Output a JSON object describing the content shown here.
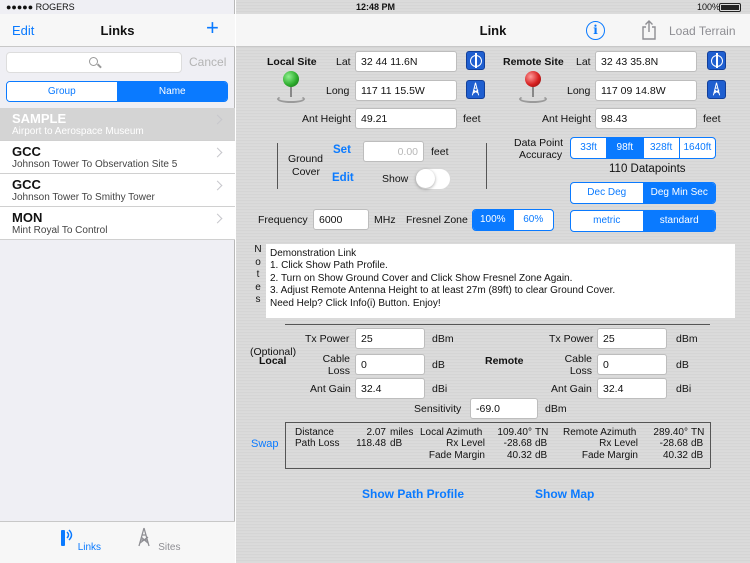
{
  "status": {
    "carrier": "●●●●● ROGERS",
    "time": "12:48 PM",
    "battery": "100%"
  },
  "left": {
    "edit": "Edit",
    "title": "Links",
    "add": "+",
    "cancel": "Cancel",
    "segments": [
      "Group",
      "Name"
    ],
    "items": [
      {
        "title": "SAMPLE",
        "subtitle": "Airport to Aerospace Museum"
      },
      {
        "title": "GCC",
        "subtitle": "Johnson Tower To Observation Site 5"
      },
      {
        "title": "GCC",
        "subtitle": "Johnson Tower To Smithy Tower"
      },
      {
        "title": "MON",
        "subtitle": "Mint Royal To Control"
      }
    ],
    "tabs": {
      "links": "Links",
      "sites": "Sites"
    }
  },
  "nav": {
    "title": "Link",
    "info": "i",
    "load_terrain": "Load Terrain"
  },
  "local": {
    "label": "Local Site",
    "lat": "32 44 11.6N",
    "long": "117 11 15.5W",
    "ant_height": "49.21"
  },
  "remote": {
    "label": "Remote Site",
    "lat": "32 43 35.8N",
    "long": "117 09 14.8W",
    "ant_height": "98.43"
  },
  "labels": {
    "lat": "Lat",
    "long": "Long",
    "ant_height": "Ant Height",
    "feet": "feet",
    "ground": "Ground",
    "cover": "Cover",
    "set": "Set",
    "edit": "Edit",
    "show": "Show",
    "data_point": "Data Point",
    "accuracy": "Accuracy",
    "frequency": "Frequency",
    "mhz": "MHz",
    "fresnel_zone": "Fresnel Zone",
    "notes_letters": [
      "N",
      "o",
      "t",
      "e",
      "s"
    ],
    "tx_power": "Tx Power",
    "dbm": "dBm",
    "cable": "Cable",
    "loss": "Loss",
    "db": "dB",
    "ant_gain": "Ant Gain",
    "dbi": "dBi",
    "optional": "(Optional)",
    "local": "Local",
    "remote": "Remote",
    "sensitivity": "Sensitivity",
    "swap": "Swap"
  },
  "ground_cover_value": "0.00",
  "accuracy_options": [
    "33ft",
    "98ft",
    "328ft",
    "1640ft"
  ],
  "accuracy_selected": "98ft",
  "datapoints": "110  Datapoints",
  "coord_format": [
    "Dec Deg",
    "Deg Min Sec"
  ],
  "coord_selected": "Deg Min Sec",
  "units": [
    "metric",
    "standard"
  ],
  "units_selected": "standard",
  "frequency": "6000",
  "fresnel_options": [
    "100%",
    "60%"
  ],
  "fresnel_selected": "100%",
  "notes": [
    "Demonstration Link",
    "1. Click Show Path Profile.",
    "2. Turn on Show Ground Cover and Click Show Fresnel Zone Again.",
    "3. Adjust Remote Antenna Height to at least 27m (89ft) to clear Ground Cover.",
    "Need Help? Click Info(i) Button.     Enjoy!"
  ],
  "radio": {
    "local_tx": "25",
    "local_cable": "0",
    "local_gain": "32.4",
    "remote_tx": "25",
    "remote_cable": "0",
    "remote_gain": "32.4",
    "sensitivity": "-69.0"
  },
  "results": {
    "distance_label": "Distance",
    "distance": "2.07",
    "distance_unit": "miles",
    "path_loss_label": "Path Loss",
    "path_loss": "118.48",
    "path_loss_unit": "dB",
    "local_azimuth_label": "Local Azimuth",
    "local_azimuth": "109.40°",
    "local_azimuth_unit": "TN",
    "rx_level_label": "Rx Level",
    "local_rx": "-28.68",
    "local_rx_unit": "dB",
    "fade_margin_label": "Fade Margin",
    "local_fade": "40.32",
    "local_fade_unit": "dB",
    "remote_azimuth_label": "Remote Azimuth",
    "remote_azimuth": "289.40°",
    "remote_azimuth_unit": "TN",
    "remote_rx": "-28.68",
    "remote_rx_unit": "dB",
    "remote_fade": "40.32",
    "remote_fade_unit": "dB"
  },
  "actions": {
    "show_path_profile": "Show Path Profile",
    "show_map": "Show Map"
  },
  "colors": {
    "accent": "#0a7aff",
    "local_pin": "#2fae2f",
    "remote_pin": "#d62020"
  }
}
